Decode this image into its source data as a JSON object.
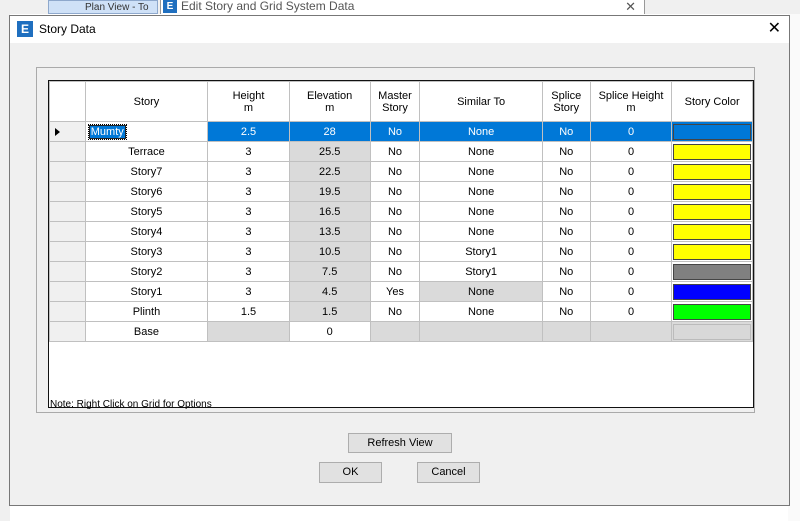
{
  "background": {
    "tab_label": "Plan View - To",
    "back_window_title": "Edit Story and Grid System Data",
    "app_icon_letter": "E"
  },
  "dialog": {
    "title": "Story Data",
    "close_glyph": "✕",
    "app_icon_letter": "E"
  },
  "table": {
    "headers": {
      "story": "Story",
      "height": "Height\nm",
      "elevation": "Elevation\nm",
      "master_story": "Master\nStory",
      "similar_to": "Similar To",
      "splice_story": "Splice\nStory",
      "splice_height": "Splice Height\nm",
      "story_color": "Story Color"
    },
    "rows": [
      {
        "story": "Mumty",
        "height": "2.5",
        "elevation": "28",
        "master": "No",
        "similar": "None",
        "splice": "No",
        "splice_height": "0",
        "color": "#0078d7"
      },
      {
        "story": "Terrace",
        "height": "3",
        "elevation": "25.5",
        "master": "No",
        "similar": "None",
        "splice": "No",
        "splice_height": "0",
        "color": "#ffff00"
      },
      {
        "story": "Story7",
        "height": "3",
        "elevation": "22.5",
        "master": "No",
        "similar": "None",
        "splice": "No",
        "splice_height": "0",
        "color": "#ffff00"
      },
      {
        "story": "Story6",
        "height": "3",
        "elevation": "19.5",
        "master": "No",
        "similar": "None",
        "splice": "No",
        "splice_height": "0",
        "color": "#ffff00"
      },
      {
        "story": "Story5",
        "height": "3",
        "elevation": "16.5",
        "master": "No",
        "similar": "None",
        "splice": "No",
        "splice_height": "0",
        "color": "#ffff00"
      },
      {
        "story": "Story4",
        "height": "3",
        "elevation": "13.5",
        "master": "No",
        "similar": "None",
        "splice": "No",
        "splice_height": "0",
        "color": "#ffff00"
      },
      {
        "story": "Story3",
        "height": "3",
        "elevation": "10.5",
        "master": "No",
        "similar": "Story1",
        "splice": "No",
        "splice_height": "0",
        "color": "#ffff00"
      },
      {
        "story": "Story2",
        "height": "3",
        "elevation": "7.5",
        "master": "No",
        "similar": "Story1",
        "splice": "No",
        "splice_height": "0",
        "color": "#808080"
      },
      {
        "story": "Story1",
        "height": "3",
        "elevation": "4.5",
        "master": "Yes",
        "similar": "None",
        "splice": "No",
        "splice_height": "0",
        "color": "#0000ff"
      },
      {
        "story": "Plinth",
        "height": "1.5",
        "elevation": "1.5",
        "master": "No",
        "similar": "None",
        "splice": "No",
        "splice_height": "0",
        "color": "#00ff00"
      },
      {
        "story": "Base",
        "height": "",
        "elevation": "0",
        "master": "",
        "similar": "",
        "splice": "",
        "splice_height": "",
        "color": "#d8d8d8"
      }
    ]
  },
  "note": "Note:  Right Click on Grid for Options",
  "buttons": {
    "refresh": "Refresh View",
    "ok": "OK",
    "cancel": "Cancel"
  }
}
